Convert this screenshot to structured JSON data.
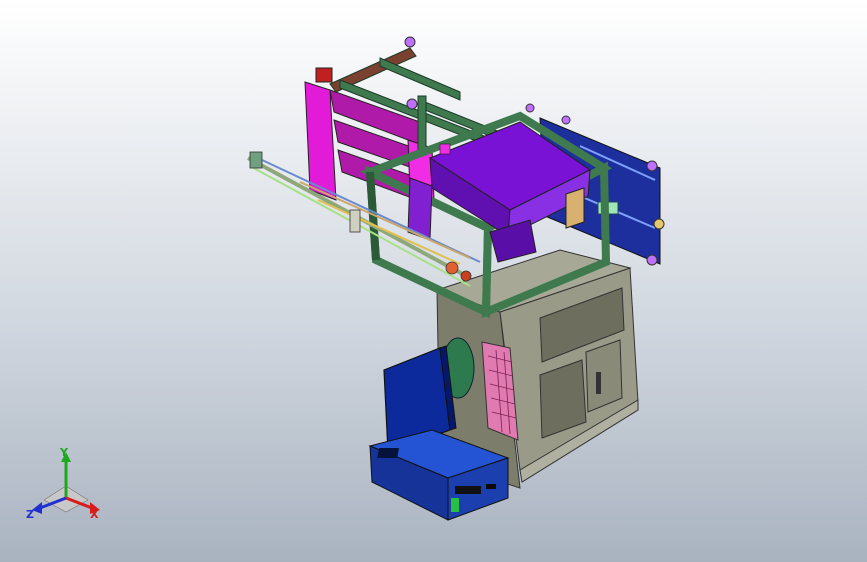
{
  "viewport": {
    "background_top": "#ffffff",
    "background_bottom": "#a9b3c0"
  },
  "triad": {
    "x_label": "X",
    "y_label": "Y",
    "z_label": "Z",
    "x_color": "#d81c1c",
    "y_color": "#1ea81e",
    "z_color": "#2030d0"
  },
  "colors": {
    "frame_green": "#3e7a4e",
    "hopper_purple": "#7a12d6",
    "panel_magenta": "#e21bd8",
    "plate_blue": "#1d2f9c",
    "cabinet_gray": "#8c8c7a",
    "pc_blue": "#1c3fb0",
    "monitor_blue": "#0c2a9c",
    "keyboard_pink": "#e07ab0",
    "disc_green": "#2d7a4f"
  }
}
